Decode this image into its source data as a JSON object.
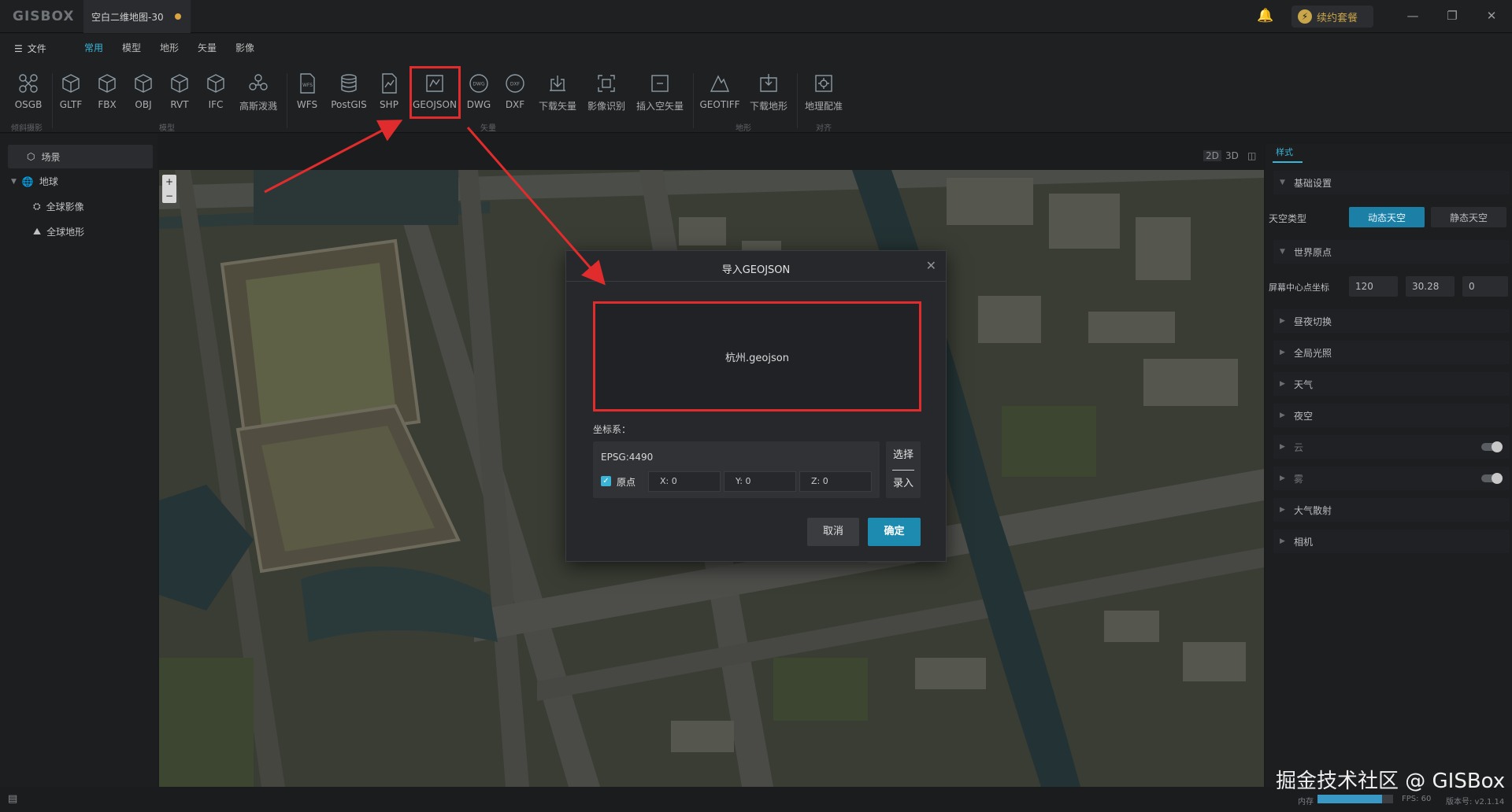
{
  "app": {
    "logo": "GISBOX",
    "document_tab": "空白二维地图-30",
    "plan_button": "续约套餐"
  },
  "menu": {
    "file": "文件",
    "tabs": [
      "常用",
      "模型",
      "地形",
      "矢量",
      "影像"
    ],
    "active_tab": "常用"
  },
  "toolbar": {
    "tools": [
      {
        "id": "osgb",
        "label": "OSGB"
      },
      {
        "id": "gltf",
        "label": "GLTF"
      },
      {
        "id": "fbx",
        "label": "FBX"
      },
      {
        "id": "obj",
        "label": "OBJ"
      },
      {
        "id": "rvt",
        "label": "RVT"
      },
      {
        "id": "ifc",
        "label": "IFC"
      },
      {
        "id": "gaussian",
        "label": "高斯泼溅"
      },
      {
        "id": "wfs",
        "label": "WFS"
      },
      {
        "id": "postgis",
        "label": "PostGIS"
      },
      {
        "id": "shp",
        "label": "SHP"
      },
      {
        "id": "geojson",
        "label": "GEOJSON"
      },
      {
        "id": "dwg",
        "label": "DWG"
      },
      {
        "id": "dxf",
        "label": "DXF"
      },
      {
        "id": "download-vector",
        "label": "下载矢量"
      },
      {
        "id": "image-recognition",
        "label": "影像识别"
      },
      {
        "id": "insert-empty-vector",
        "label": "插入空矢量"
      },
      {
        "id": "geotiff",
        "label": "GEOTIFF"
      },
      {
        "id": "download-terrain",
        "label": "下载地形"
      },
      {
        "id": "georeference",
        "label": "地理配准"
      }
    ],
    "groups": [
      "倾斜摄影",
      "模型",
      "矢量",
      "地形",
      "对齐"
    ]
  },
  "scene_tree": {
    "root": "场景",
    "earth": "地球",
    "children": [
      "全球影像",
      "全球地形"
    ]
  },
  "view": {
    "modes": [
      "2D",
      "3D",
      "◫"
    ]
  },
  "right_panel": {
    "tab": "样式",
    "basic_settings": "基础设置",
    "sky_type_label": "天空类型",
    "sky_options": [
      "动态天空",
      "静态天空"
    ],
    "sky_selected": "动态天空",
    "world_origin": "世界原点",
    "screen_center_label": "屏幕中心点坐标",
    "screen_center": [
      "120",
      "30.28",
      "0"
    ],
    "sections": [
      "昼夜切换",
      "全局光照",
      "天气",
      "夜空",
      "云",
      "雾",
      "大气散射",
      "相机"
    ]
  },
  "dialog": {
    "title": "导入GEOJSON",
    "file_name": "杭州.geojson",
    "crs_label": "坐标系：",
    "crs_value": "EPSG:4490",
    "origin_label": "原点",
    "origin_checked": true,
    "x": "X: 0",
    "y": "Y: 0",
    "z": "Z: 0",
    "select_button": "选择",
    "enter_button": "录入",
    "cancel_button": "取消",
    "ok_button": "确定"
  },
  "status": {
    "memory_label": "内存",
    "memory_fraction": 0.85,
    "fps": "FPS: 60",
    "version": "版本号: v2.1.14"
  },
  "watermark": "掘金技术社区 @ GISBox",
  "colors": {
    "accent": "#3ab5d8",
    "highlight": "#e02c2c",
    "primary_button": "#1d8bb0"
  }
}
